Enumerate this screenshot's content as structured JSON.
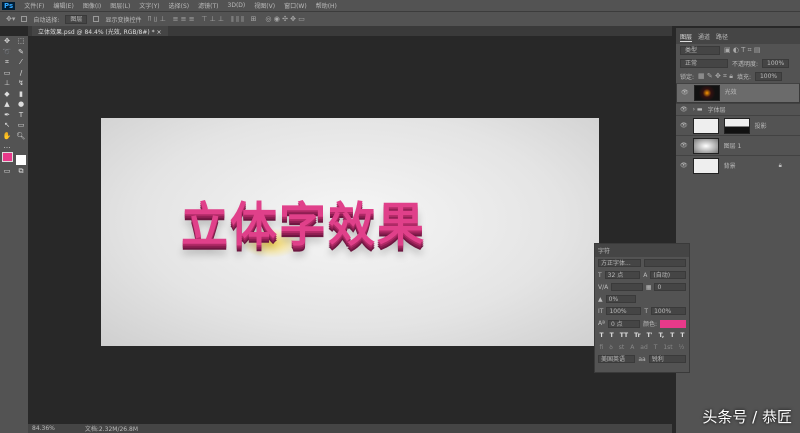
{
  "menubar": {
    "logo": "Ps",
    "items": [
      "文件(F)",
      "编辑(E)",
      "图像(I)",
      "图层(L)",
      "文字(Y)",
      "选择(S)",
      "滤镜(T)",
      "3D(D)",
      "视图(V)",
      "窗口(W)",
      "帮助(H)"
    ]
  },
  "options": {
    "auto_select_label": "自动选择:",
    "auto_select_value": "图层",
    "show_transform_label": "显示变换控件"
  },
  "document": {
    "tab_title": "立体效果.psd @ 84.4% (光效, RGB/8#) *",
    "canvas_text": "立体字效果"
  },
  "status": {
    "zoom": "84.36%",
    "doc_size": "文档:2.32M/26.8M"
  },
  "layers_panel": {
    "tabs": [
      "图层",
      "通道",
      "路径"
    ],
    "filter": "类型",
    "blend_mode": "正常",
    "opacity_label": "不透明度:",
    "opacity": "100%",
    "lock_label": "锁定:",
    "fill_label": "填充:",
    "fill": "100%",
    "layers": [
      {
        "name": "光效",
        "selected": true
      },
      {
        "name": "字体层",
        "group": true
      },
      {
        "name": "投影"
      },
      {
        "name": "图层 1"
      },
      {
        "name": "背景",
        "locked": true
      }
    ]
  },
  "character_panel": {
    "title": "字符",
    "font": "方正字体...",
    "size": "32 点",
    "leading": "(自动)",
    "kerning": "V/A",
    "tracking": "0",
    "scale_label": "0%",
    "vscale": "100%",
    "hscale": "100%",
    "baseline": "0 点",
    "color_label": "颜色:",
    "color": "#e8398a",
    "language": "美国英语",
    "aa_label": "aa",
    "aa": "锐利"
  },
  "watermark": "头条号 / 恭匠"
}
